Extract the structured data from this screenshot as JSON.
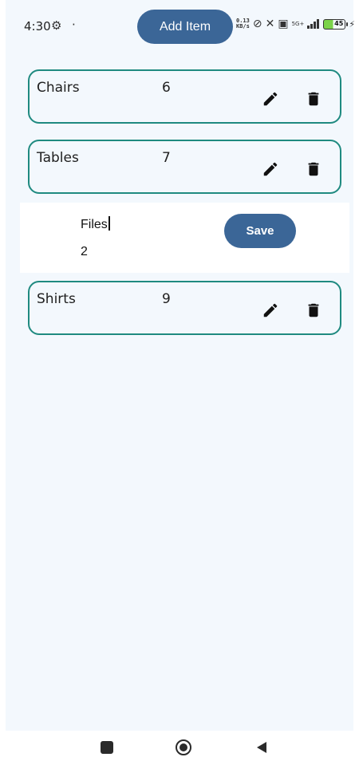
{
  "status_bar": {
    "time": "4:30",
    "speed_value": "0.13",
    "speed_unit": "KB/s",
    "network": "5G+",
    "battery": "45"
  },
  "toolbar": {
    "add_label": "Add Item"
  },
  "items": [
    {
      "name": "Chairs",
      "quantity": "6"
    },
    {
      "name": "Tables",
      "quantity": "7"
    },
    {
      "name": "Shirts",
      "quantity": "9"
    }
  ],
  "editor": {
    "name_value": "Files",
    "quantity_value": "2",
    "save_label": "Save"
  },
  "icons": {
    "edit": "pencil-icon",
    "delete": "trash-icon"
  },
  "colors": {
    "accent": "#3b6697",
    "card_border": "#1f8a80",
    "background": "#f3f8fd"
  }
}
